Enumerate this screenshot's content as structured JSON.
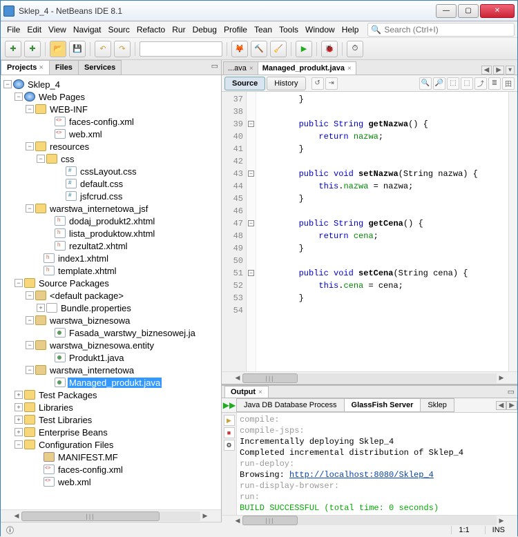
{
  "window": {
    "title": "Sklep_4 - NetBeans IDE 8.1"
  },
  "menu": {
    "items": [
      "File",
      "Edit",
      "View",
      "Navigat",
      "Sourc",
      "Refacto",
      "Rur",
      "Debug",
      "Profile",
      "Tean",
      "Tools",
      "Window",
      "Help"
    ]
  },
  "search": {
    "placeholder": "Search (Ctrl+I)"
  },
  "leftPanel": {
    "tabs": {
      "projects": "Projects",
      "files": "Files",
      "services": "Services"
    }
  },
  "tree": {
    "project": "Sklep_4",
    "webpages": "Web Pages",
    "webinf": "WEB-INF",
    "facesconfig": "faces-config.xml",
    "webxml": "web.xml",
    "resources": "resources",
    "css": "css",
    "csslayout": "cssLayout.css",
    "defaultcss": "default.css",
    "jsfcrud": "jsfcrud.css",
    "wij": "warstwa_internetowa_jsf",
    "dodaj": "dodaj_produkt2.xhtml",
    "lista": "lista_produktow.xhtml",
    "rezultat": "rezultat2.xhtml",
    "index1": "index1.xhtml",
    "template": "template.xhtml",
    "srcpkg": "Source Packages",
    "defpkg": "<default package>",
    "bundle": "Bundle.properties",
    "wb": "warstwa_biznesowa",
    "fasada": "Fasada_warstwy_biznesowej.ja",
    "wbe": "warstwa_biznesowa.entity",
    "produkt1": "Produkt1.java",
    "wi": "warstwa_internetowa",
    "managed": "Managed_produkt.java",
    "testpkg": "Test Packages",
    "libs": "Libraries",
    "testlibs": "Test Libraries",
    "eb": "Enterprise Beans",
    "conf": "Configuration Files",
    "manifest": "MANIFEST.MF",
    "facesconfig2": "faces-config.xml",
    "webxml2": "web.xml"
  },
  "editor": {
    "tabs": {
      "collapsed": "...ava",
      "active": "Managed_produkt.java"
    },
    "viewTabs": {
      "source": "Source",
      "history": "History"
    },
    "firstLine": 37,
    "lines": {
      "l37": "        }",
      "l38": "",
      "l41": "        }",
      "l42": "",
      "l45": "        }",
      "l46": "",
      "l49": "        }",
      "l50": "",
      "l53": "        }",
      "l54": ""
    },
    "kw": {
      "public_": "public",
      "String_": "String",
      "void_": "void",
      "return_": "return",
      "this_": "this"
    },
    "id": {
      "getNazwa": "getNazwa",
      "setNazwa": "setNazwa",
      "getCena": "getCena",
      "setCena": "setCena"
    },
    "fld": {
      "nazwa": "nazwa",
      "cena": "cena"
    },
    "txt": {
      "open_brace": "() {",
      "setNazwa_sig": "(String nazwa) {",
      "setCena_sig": "(String cena) {",
      "eq_nazwa": " = nazwa;",
      "eq_cena": " = cena;",
      "semi": ";"
    }
  },
  "output": {
    "label": "Output",
    "subtabs": {
      "jdb": "Java DB Database Process",
      "gf": "GlassFish Server",
      "sklep": "Sklep"
    },
    "lines": {
      "compile": "compile:",
      "compilejsps": "compile-jsps:",
      "inc": "Incrementally deploying Sklep_4",
      "completed": "Completed incremental distribution of Sklep_4",
      "rundeploy": "run-deploy:",
      "browsing": "Browsing: ",
      "url": "http://localhost:8080/Sklep_4",
      "rdb": "run-display-browser:",
      "run": "run:",
      "build": "BUILD SUCCESSFUL (total time: 0 seconds)"
    }
  },
  "status": {
    "pos": "1:1",
    "ins": "INS"
  }
}
